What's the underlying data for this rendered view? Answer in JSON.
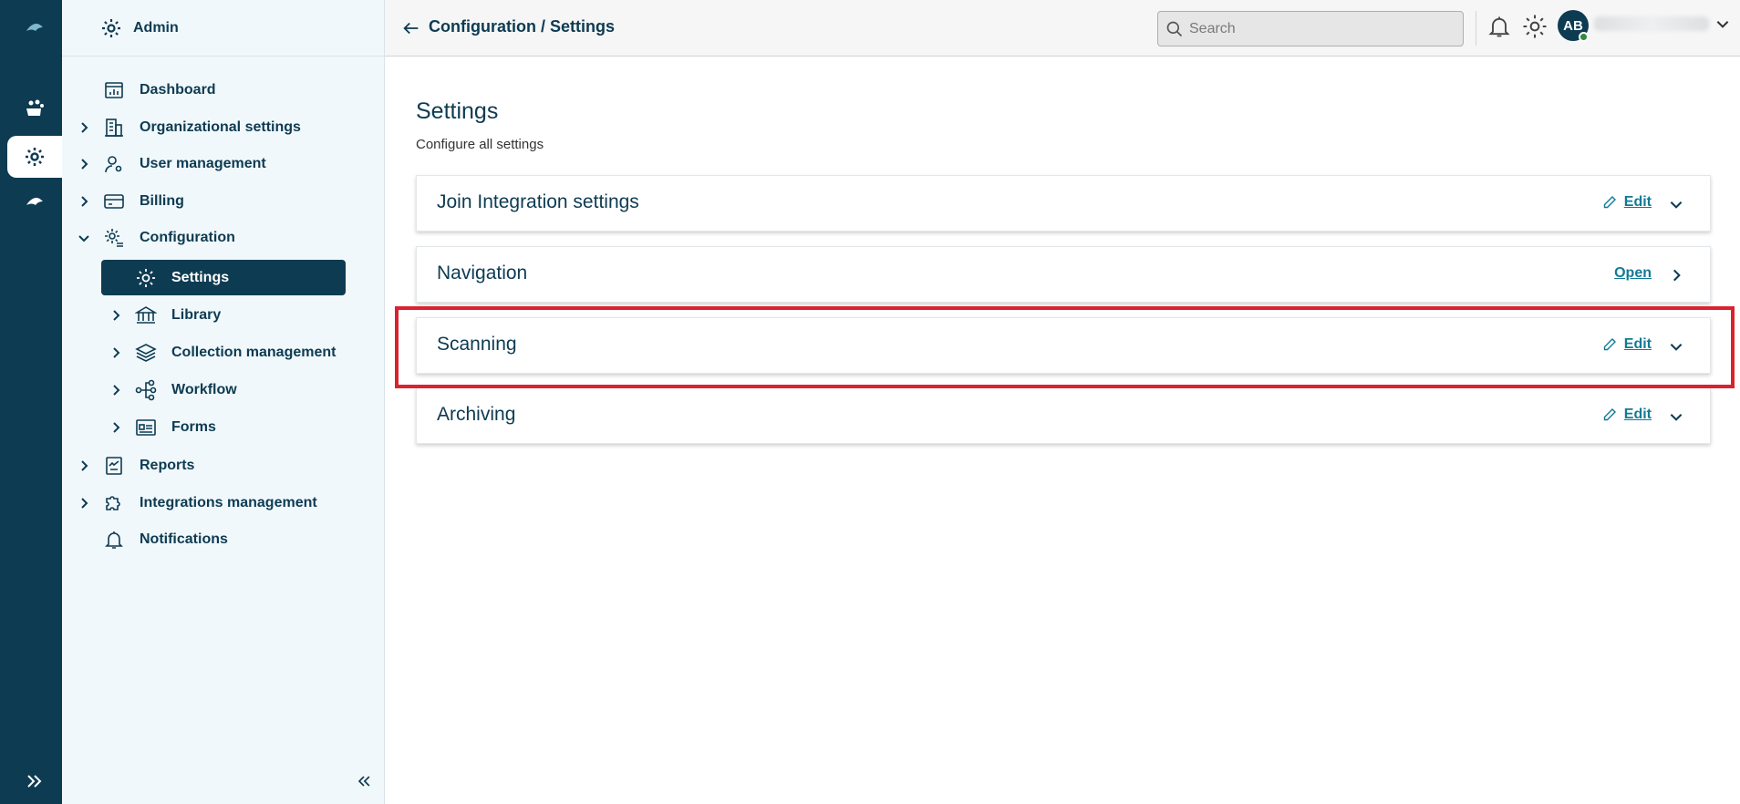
{
  "sidebar": {
    "header": "Admin",
    "items": [
      {
        "label": "Dashboard"
      },
      {
        "label": "Organizational settings"
      },
      {
        "label": "User management"
      },
      {
        "label": "Billing"
      },
      {
        "label": "Configuration"
      },
      {
        "label": "Settings"
      },
      {
        "label": "Library"
      },
      {
        "label": "Collection management"
      },
      {
        "label": "Workflow"
      },
      {
        "label": "Forms"
      },
      {
        "label": "Reports"
      },
      {
        "label": "Integrations management"
      },
      {
        "label": "Notifications"
      }
    ]
  },
  "topbar": {
    "breadcrumb": "Configuration / Settings",
    "search_placeholder": "Search",
    "avatar_initials": "AB"
  },
  "main": {
    "title": "Settings",
    "subtitle": "Configure all settings",
    "panels": [
      {
        "title": "Join Integration settings",
        "action": "Edit"
      },
      {
        "title": "Navigation",
        "action": "Open"
      },
      {
        "title": "Scanning",
        "action": "Edit"
      },
      {
        "title": "Archiving",
        "action": "Edit"
      }
    ]
  },
  "colors": {
    "brand_dark": "#0d3b52",
    "link": "#127a96",
    "highlight": "#d9232e",
    "sidebar_bg": "#f1f8fb"
  }
}
